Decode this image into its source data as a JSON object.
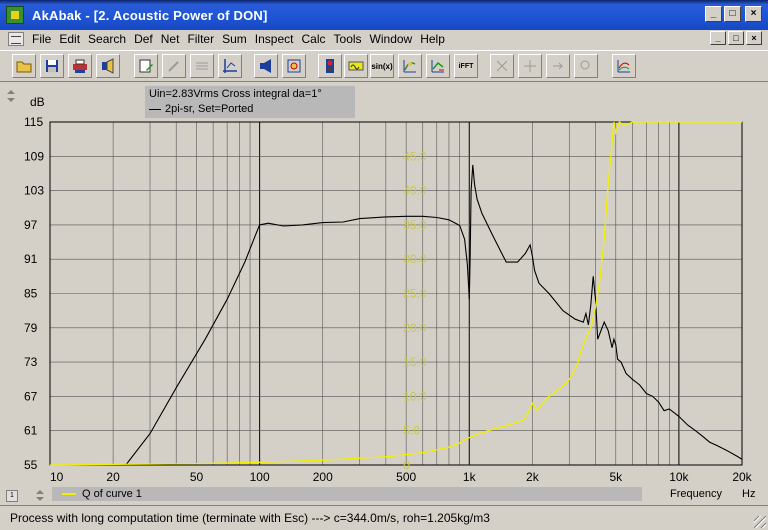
{
  "window": {
    "title": "AkAbak - [2. Acoustic Power of DON]",
    "controls": [
      "_",
      "□",
      "×"
    ]
  },
  "menu": {
    "items": [
      "File",
      "Edit",
      "Search",
      "Def",
      "Net",
      "Filter",
      "Sum",
      "Inspect",
      "Calc",
      "Tools",
      "Window",
      "Help"
    ]
  },
  "toolbar": {
    "sin_label": "sin(x)",
    "ifft_label": "iFFT"
  },
  "info": {
    "line1": "Uin=2.83Vrms Cross integral da=1°",
    "line2": "2pi-sr, Set=Ported"
  },
  "legend": {
    "label": "Q of curve 1"
  },
  "status": {
    "text": "Process with long computation time (terminate with Esc) ---> c=344.0m/s, roh=1.205kg/m3"
  },
  "colors": {
    "plot_bg": "#d4d0c8",
    "black_curve": "#000000",
    "yellow_curve": "#f0f000",
    "right_axis_text": "#c8c84a"
  },
  "chart_data": {
    "type": "line",
    "xscale": "log",
    "xlim": [
      10,
      20000
    ],
    "ylim": [
      55,
      115
    ],
    "ylabel": "dB",
    "xlabel": "Frequency",
    "xunit": "Hz",
    "y_ticks": [
      115,
      109,
      103,
      97,
      91,
      85,
      79,
      73,
      67,
      61,
      55
    ],
    "x_tick_labels": [
      {
        "v": 10,
        "t": "10"
      },
      {
        "v": 20,
        "t": "20"
      },
      {
        "v": 50,
        "t": "50"
      },
      {
        "v": 100,
        "t": "100"
      },
      {
        "v": 200,
        "t": "200"
      },
      {
        "v": 500,
        "t": "500"
      },
      {
        "v": 1000,
        "t": "1k"
      },
      {
        "v": 2000,
        "t": "2k"
      },
      {
        "v": 5000,
        "t": "5k"
      },
      {
        "v": 10000,
        "t": "10k"
      },
      {
        "v": 20000,
        "t": "20k"
      }
    ],
    "right_axis": {
      "lim": [
        0,
        50
      ],
      "ticks": [
        45.0,
        40.0,
        35.0,
        30.0,
        25.0,
        20.0,
        15.0,
        10.0,
        5.0,
        0.0
      ],
      "tick_labels": [
        "45.0",
        "40.0",
        "35.0",
        "30.0",
        "25.0",
        "20.0",
        "15.0",
        "10.0",
        "5.0",
        "0"
      ]
    },
    "series": [
      {
        "axis": "left",
        "color": "#000000",
        "x": [
          23,
          30,
          40,
          55,
          70,
          85,
          95,
          100,
          110,
          130,
          160,
          200,
          250,
          300,
          400,
          500,
          600,
          700,
          800,
          900,
          950,
          980,
          1000,
          1010,
          1020,
          1040,
          1060,
          1090,
          1150,
          1300,
          1500,
          1700,
          1850,
          1950,
          2000,
          2050,
          2150,
          2400,
          2800,
          3200,
          3500,
          3600,
          3700,
          3800,
          3900,
          4000,
          4050,
          4100,
          4200,
          4400,
          4600,
          4800,
          4900,
          5000,
          5100,
          5300,
          5600,
          6000,
          6500,
          7000,
          7500,
          8000,
          8500,
          9000,
          10000,
          11000,
          12000,
          13000,
          14000,
          15000,
          16000,
          17000,
          18000,
          19000,
          20000
        ],
        "y": [
          55,
          60.5,
          68.5,
          77,
          84,
          90.5,
          95,
          97,
          97.3,
          96.8,
          97,
          97.4,
          97.5,
          98.1,
          98.4,
          98.5,
          98.5,
          98.3,
          97.9,
          96.9,
          94.5,
          90,
          84,
          92,
          103,
          107.5,
          104,
          101.5,
          99,
          95,
          90.5,
          90.5,
          92,
          93.5,
          91.5,
          89,
          86.8,
          85,
          82,
          80.5,
          80,
          81.5,
          79.5,
          83,
          88,
          84,
          80.5,
          77,
          78,
          80,
          78.5,
          75.5,
          77,
          76,
          73.5,
          73,
          71,
          70,
          69,
          67.5,
          67,
          66,
          64.5,
          64.8,
          63.5,
          62,
          61,
          60,
          59,
          58.5,
          58,
          57.5,
          57,
          56.5,
          56
        ]
      },
      {
        "axis": "right",
        "color": "#f0f000",
        "x": [
          10,
          50,
          100,
          200,
          400,
          600,
          800,
          900,
          1000,
          1100,
          1300,
          1600,
          1800,
          1900,
          2000,
          2100,
          2400,
          2800,
          3000,
          3200,
          3300,
          3400,
          3600,
          3800,
          4000,
          4200,
          4400,
          4600,
          4800,
          4900,
          5000,
          5200,
          5500,
          6000,
          8000,
          12000,
          20000
        ],
        "y": [
          0,
          0.2,
          0.4,
          0.7,
          1.2,
          1.8,
          2.6,
          3.2,
          4.0,
          4.5,
          5.2,
          6.0,
          6.5,
          7.5,
          9.0,
          8.0,
          10.0,
          11.5,
          12.5,
          14.0,
          15.0,
          16.5,
          18.5,
          20.0,
          23.0,
          27.0,
          33.0,
          41.0,
          47.0,
          50.0,
          48.5,
          50.0,
          49.5,
          50.0,
          50.0,
          50.0,
          50.0
        ]
      }
    ]
  }
}
